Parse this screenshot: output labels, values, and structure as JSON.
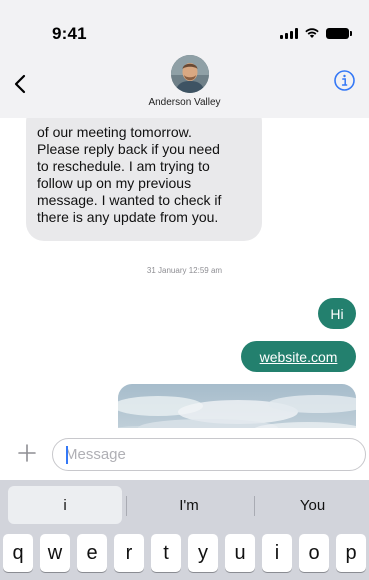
{
  "status_bar": {
    "time": "9:41",
    "icons": [
      "cellular-signal-icon",
      "wifi-icon",
      "battery-icon"
    ]
  },
  "header": {
    "contact_name": "Anderson Valley",
    "back_icon": "chevron-left-icon",
    "info_icon": "info-circle-icon"
  },
  "messages": {
    "incoming_text_lines": [
      "of our meeting tomorrow.",
      "Please reply back if you need",
      "to reschedule. I am trying to",
      "follow up on my previous",
      "message. I wanted to check if",
      "there is any update from you."
    ],
    "timestamp": "31 January 12:59 am",
    "outgoing_1": "Hi",
    "outgoing_2": "website.com"
  },
  "composer": {
    "add_icon": "plus-icon",
    "placeholder": "Message",
    "value": ""
  },
  "keyboard": {
    "suggestions": [
      "i",
      "I'm",
      "You"
    ],
    "top_row_keys": [
      "q",
      "w",
      "e",
      "r",
      "t",
      "y",
      "u",
      "i",
      "o",
      "p"
    ]
  },
  "colors": {
    "outgoing_bubble": "#23806e",
    "incoming_bubble": "#e9e9eb",
    "accent": "#3478f6",
    "keyboard_bg": "#d2d4db"
  }
}
